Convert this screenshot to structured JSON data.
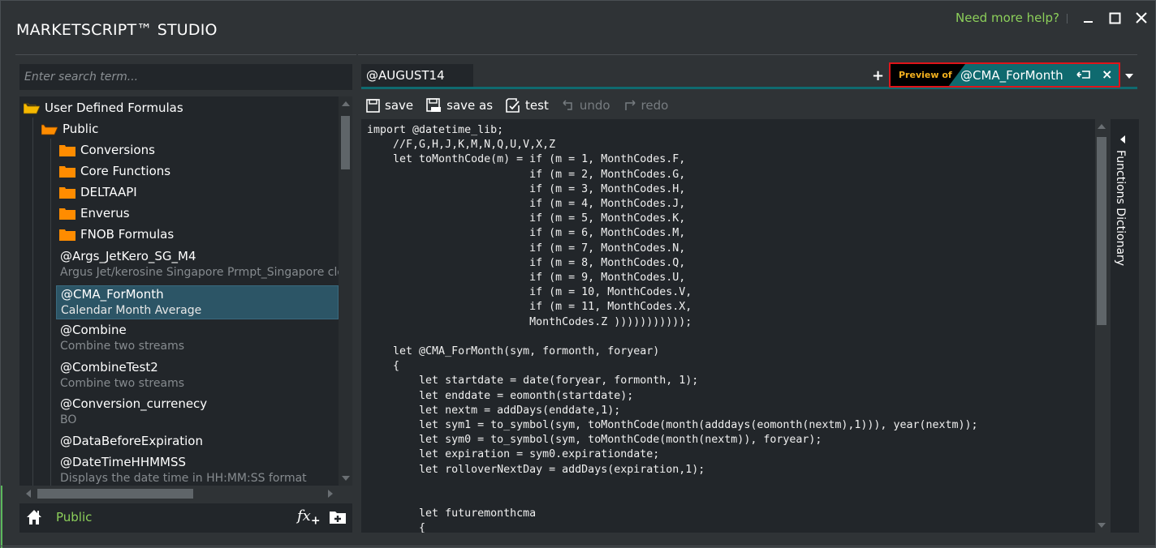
{
  "app": {
    "title": "MARKETSCRIPT™ STUDIO",
    "help_link": "Need more help?"
  },
  "window_controls": {
    "minimize_icon": "minimize-icon",
    "maximize_icon": "maximize-icon",
    "close_icon": "close-icon"
  },
  "sidebar": {
    "search_placeholder": "Enter search term...",
    "tree": {
      "root": "User Defined Formulas",
      "public": "Public",
      "folders": [
        "Conversions",
        "Core Functions",
        "DELTAAPI",
        "Enverus",
        "FNOB Formulas"
      ],
      "formulas": [
        {
          "name": "@Args_JetKero_SG_M4",
          "description": "Argus Jet/kerosine Singapore Prmpt_Singapore close Singapore",
          "selected": false
        },
        {
          "name": "@CMA_ForMonth",
          "description": "Calendar Month Average",
          "selected": true
        },
        {
          "name": "@Combine",
          "description": "Combine two streams",
          "selected": false
        },
        {
          "name": "@CombineTest2",
          "description": "Combine two streams",
          "selected": false
        },
        {
          "name": "@Conversion_currenecy",
          "description": "BO",
          "selected": false
        },
        {
          "name": "@DataBeforeExpiration",
          "description": "",
          "selected": false
        },
        {
          "name": "@DateTimeHHMMSS",
          "description": "Displays the date time in HH:MM:SS format",
          "selected": false
        }
      ]
    },
    "footer": {
      "breadcrumb": "Public",
      "fx_label": "fx",
      "fx_plus": "+"
    }
  },
  "editor": {
    "tabs": [
      {
        "label": "@AUGUST14",
        "active": true
      }
    ],
    "add_tab_label": "+",
    "preview_tab": {
      "prefix": "Preview of",
      "name": "@CMA_ForMonth",
      "close_label": "×"
    },
    "toolbar": {
      "save": "save",
      "save_as": "save as",
      "test": "test",
      "undo": "undo",
      "redo": "redo"
    },
    "code": "import @datetime_lib;\n    //F,G,H,J,K,M,N,Q,U,V,X,Z\n    let toMonthCode(m) = if (m = 1, MonthCodes.F,\n                         if (m = 2, MonthCodes.G,\n                         if (m = 3, MonthCodes.H,\n                         if (m = 4, MonthCodes.J,\n                         if (m = 5, MonthCodes.K,\n                         if (m = 6, MonthCodes.M,\n                         if (m = 7, MonthCodes.N,\n                         if (m = 8, MonthCodes.Q,\n                         if (m = 9, MonthCodes.U,\n                         if (m = 10, MonthCodes.V,\n                         if (m = 11, MonthCodes.X,\n                         MonthCodes.Z )))))))))));\n\n    let @CMA_ForMonth(sym, formonth, foryear)\n    {\n        let startdate = date(foryear, formonth, 1);\n        let enddate = eomonth(startdate);\n        let nextm = addDays(enddate,1);\n        let sym1 = to_symbol(sym, toMonthCode(month(adddays(eomonth(nextm),1))), year(nextm));\n        let sym0 = to_symbol(sym, toMonthCode(month(nextm)), foryear);\n        let expiration = sym0.expirationdate;\n        let rolloverNextDay = addDays(expiration,1);\n\n\n        let futuremonthcma\n        {"
  },
  "functions_dictionary": {
    "label": "Functions Dictionary"
  },
  "colors": {
    "accent_teal": "#0f6a6f",
    "help_green": "#8ccf5a",
    "folder_orange": "#ff8c00",
    "folder_yellow": "#f5b800",
    "preview_gold": "#f2b01e",
    "highlight_red": "#e0141a",
    "selection_blue": "#2c5566"
  }
}
